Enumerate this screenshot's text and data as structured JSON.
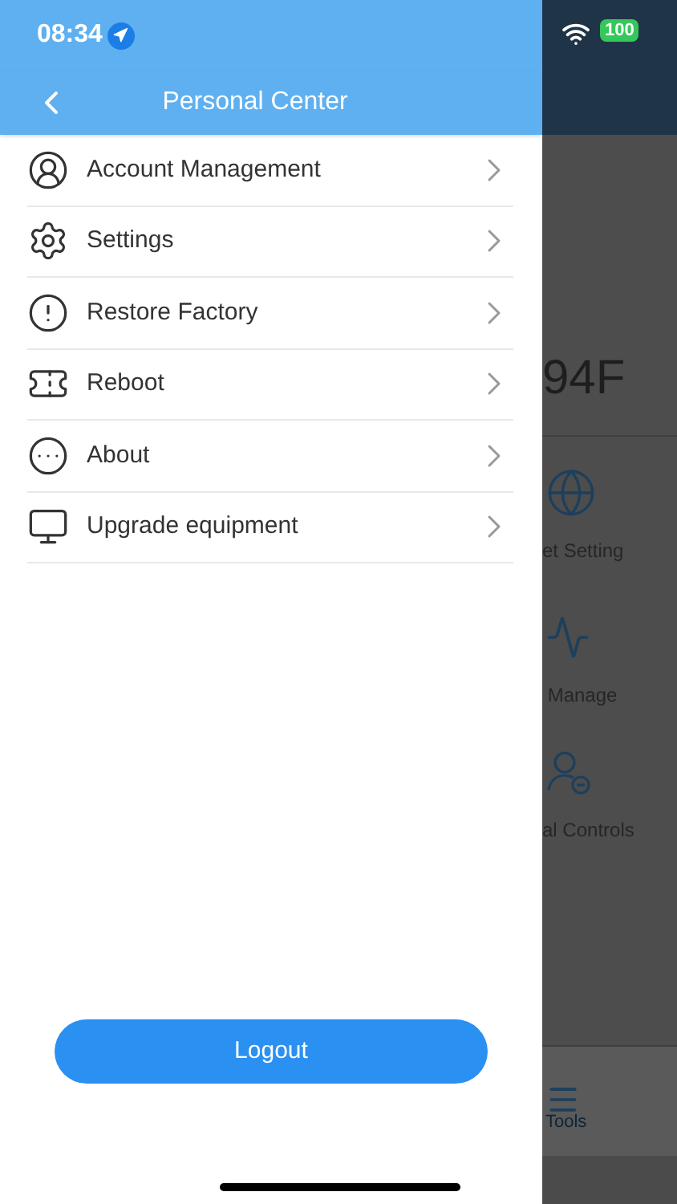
{
  "status_bar": {
    "time": "08:34",
    "battery": "100"
  },
  "drawer": {
    "title": "Personal Center",
    "items": [
      {
        "label": "Account Management"
      },
      {
        "label": "Settings"
      },
      {
        "label": "Restore Factory"
      },
      {
        "label": "Reboot"
      },
      {
        "label": "About"
      },
      {
        "label": "Upgrade equipment"
      }
    ],
    "logout": "Logout"
  },
  "background": {
    "device_name": "94F",
    "tiles": [
      {
        "label": "et Setting"
      },
      {
        "label": " Manage"
      },
      {
        "label": "al Controls"
      }
    ],
    "tab": "Tools"
  }
}
